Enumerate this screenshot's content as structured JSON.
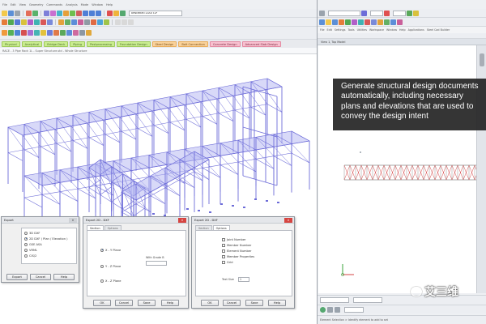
{
  "left_app": {
    "menu": [
      "File",
      "Edit",
      "View",
      "Geometry",
      "Commands",
      "Analysis",
      "Mode",
      "Window",
      "Help"
    ],
    "tool_combo": "RENDERED LOAD 1LF",
    "workflow_tabs": [
      {
        "label": "Physical",
        "style": "green"
      },
      {
        "label": "Analytical",
        "style": "green"
      },
      {
        "label": "Bridge Deck",
        "style": "green"
      },
      {
        "label": "Piping",
        "style": "green"
      },
      {
        "label": "Postprocessing",
        "style": "green"
      },
      {
        "label": "Foundation Design",
        "style": "green"
      },
      {
        "label": "Steel Design",
        "style": "alt"
      },
      {
        "label": "Bolt Connection",
        "style": "alt"
      },
      {
        "label": "Concrete Design",
        "style": "pink"
      },
      {
        "label": "Advanced Slab Design",
        "style": "pink"
      }
    ],
    "breadcrumb": "RACE - 3 Pipe Rack 1L - Super Structure.std - Whole Structure"
  },
  "export_dialog": {
    "title": "Export",
    "options": [
      {
        "label": "3D DXF",
        "selected": false
      },
      {
        "label": "2D DXF ( Plan / Elevation )",
        "selected": true
      },
      {
        "label": "GSE ASA",
        "selected": false
      },
      {
        "label": "VRML",
        "selected": false
      },
      {
        "label": "CIS/2",
        "selected": false
      }
    ],
    "buttons": {
      "export": "Export",
      "cancel": "Cancel",
      "help": "Help"
    }
  },
  "export2d_a": {
    "title": "Export 2D - DXF",
    "tabs": [
      "Section",
      "Options"
    ],
    "planes": [
      "X - Y Plane",
      "Y - Z Plane",
      "X - Z Plane"
    ],
    "combo_label": "With Grade B",
    "buttons": {
      "ok": "OK",
      "cancel": "Cancel",
      "save": "Save",
      "help": "Help"
    }
  },
  "export2d_b": {
    "title": "Export 2D - DXF",
    "tabs": [
      "Section",
      "Options"
    ],
    "checks": [
      "Joint Number",
      "Member Number",
      "Element Number",
      "Member Properties",
      "Grid"
    ],
    "text_size_label": "Text Size",
    "text_size_value": "1",
    "buttons": {
      "ok": "OK",
      "cancel": "Cancel",
      "save": "Save",
      "help": "Help"
    }
  },
  "right_app": {
    "menu": [
      "File",
      "Edit",
      "Settings",
      "Tools",
      "Utilities",
      "Workspace",
      "Window",
      "Help",
      "Applications",
      "Steel Cad Builder"
    ],
    "view_title": "View 1, Top Model",
    "status_text": "Element Selection > Identify element to add to set"
  },
  "caption": {
    "lines": [
      "Generate structural design documents",
      "automatically, including necessary",
      "plans and elevations that are used to",
      "convey the design intent"
    ]
  },
  "watermark": {
    "text": "艾三维"
  },
  "colors": {
    "model_line": "#6d6cd8",
    "model_fill": "#b8b9f2",
    "elevation_red": "#d64a4a",
    "caption_bg": "#262626"
  }
}
